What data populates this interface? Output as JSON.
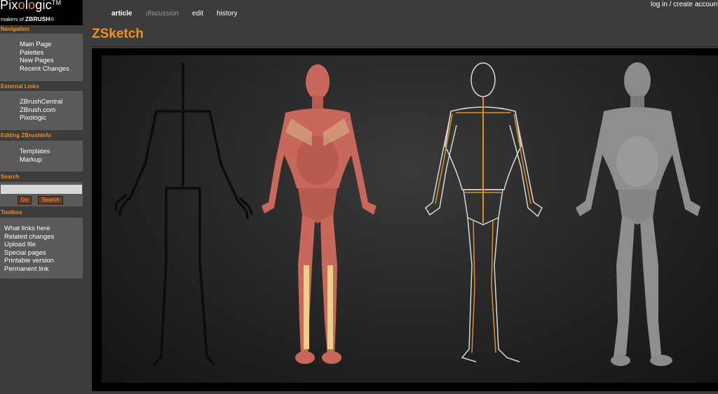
{
  "logo": {
    "brand_pre": "Pix",
    "brand_o": "o",
    "brand_l": "l",
    "brand_o2": "o",
    "brand_post": "gic",
    "brand_tm": "TM",
    "tagline_pre": "makers of ",
    "tagline_product": "ZBRUSH",
    "tagline_reg": "®"
  },
  "sidebar": {
    "navigation": {
      "title": "Navigation",
      "items": [
        "Main Page",
        "Palettes",
        "New Pages",
        "Recent Changes"
      ]
    },
    "external_links": {
      "title": "External Links",
      "items": [
        "ZBrushCentral",
        "ZBrush.com",
        "Pixologic"
      ]
    },
    "editing": {
      "title": "Editing ZBrushInfo",
      "items": [
        "Templates",
        "Markup"
      ]
    },
    "search": {
      "title": "Search",
      "input_value": "",
      "go_label": "Go",
      "search_label": "Search"
    },
    "toolbox": {
      "title": "Toolbox",
      "items": [
        "What links here",
        "Related changes",
        "Upload file",
        "Special pages",
        "Printable version",
        "Permanent link"
      ]
    }
  },
  "tabs": {
    "article": "article",
    "discussion": "discussion",
    "edit": "edit",
    "history": "history"
  },
  "user_links": {
    "login": "log in",
    "separator": " / ",
    "create": "create account"
  },
  "page": {
    "title": "ZSketch"
  },
  "colors": {
    "accent": "#f0901a",
    "background": "#3c3c3c",
    "panel": "#5a5a5a"
  }
}
